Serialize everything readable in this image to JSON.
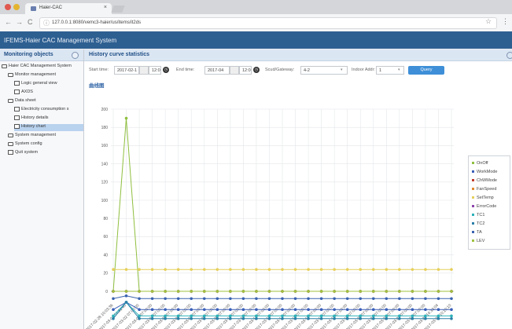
{
  "browser": {
    "tab_title": "Haier-CAC",
    "tab_close": "×",
    "url": "127.0.0.1:8080/vemc3-haier/us/items/it2ds",
    "back": "←",
    "forward": "→",
    "reload": "C",
    "info": "ⓘ",
    "star": "☆",
    "menu": "⋮"
  },
  "app": {
    "title": "IFEMS-Haier CAC Management System"
  },
  "sidebar": {
    "title": "Monitoring objects",
    "items": [
      {
        "label": "Haier CAC Management System",
        "icon": "folder",
        "level": 0
      },
      {
        "label": "Monitor management",
        "icon": "folder",
        "level": 1
      },
      {
        "label": "Logic general view",
        "icon": "page",
        "level": 2
      },
      {
        "label": "AXDS",
        "icon": "page",
        "level": 2
      },
      {
        "label": "Data sheet",
        "icon": "folder",
        "level": 1
      },
      {
        "label": "Electricity consumption s",
        "icon": "page",
        "level": 2
      },
      {
        "label": "History details",
        "icon": "page",
        "level": 2
      },
      {
        "label": "History chart",
        "icon": "page",
        "level": 2,
        "selected": true
      },
      {
        "label": "System management",
        "icon": "folder",
        "level": 1
      },
      {
        "label": "System config",
        "icon": "folder",
        "level": 1
      },
      {
        "label": "Quit system",
        "icon": "page",
        "level": 1
      }
    ]
  },
  "main": {
    "title": "History curve statistics",
    "section_label": "曲线图",
    "filters": {
      "start_label": "Start time:",
      "start_date": "2017-02-1",
      "start_time": "12:02",
      "end_label": "End time:",
      "end_date": "2017-04",
      "end_time": "12:02",
      "gateway_label": "Scud/Gateway:",
      "gateway_value": "4-2",
      "addr_label": "Indoor Addr:",
      "addr_value": "1",
      "query_label": "Query"
    }
  },
  "chart_data": {
    "type": "line",
    "title": "",
    "xlabel": "",
    "ylabel": "",
    "ylim": [
      0,
      200
    ],
    "yticks": [
      0,
      20,
      40,
      60,
      80,
      100,
      120,
      140,
      160,
      180,
      200
    ],
    "grid": true,
    "legend_position": "right",
    "categories": [
      "2017-02-28 10:03:36",
      "2017-03-01 14:31:40",
      "2017-03-02 07:00:00",
      "2017-03-03 07:00:00",
      "2017-03-04 07:00:00",
      "2017-03-05 07:00:00",
      "2017-03-06 07:00:00",
      "2017-03-07 07:00:00",
      "2017-03-08 07:00:00",
      "2017-03-09 07:00:00",
      "2017-03-10 07:00:00",
      "2017-03-11 07:00:00",
      "2017-03-12 07:00:00",
      "2017-03-13 07:00:00",
      "2017-03-14 07:00:00",
      "2017-03-15 07:00:00",
      "2017-03-16 07:00:00",
      "2017-03-17 07:00:00",
      "2017-03-18 07:00:00",
      "2017-03-19 07:00:00",
      "2017-03-20 07:00:00",
      "2017-03-21 07:00:00",
      "2017-03-22 07:00:00",
      "2017-03-23 07:00:00",
      "2017-03-24 07:00:00",
      "2017-03-25 14:33:04",
      "2017-03-26 10:10:10"
    ],
    "series": [
      {
        "name": "OnOff",
        "color": "#8fbf3f",
        "values": [
          0,
          190,
          0,
          0,
          0,
          0,
          0,
          0,
          0,
          0,
          0,
          0,
          0,
          0,
          0,
          0,
          0,
          0,
          0,
          0,
          0,
          0,
          0,
          0,
          0,
          0,
          0
        ]
      },
      {
        "name": "WorkMode",
        "color": "#3a5fb8",
        "values": [
          -20,
          -12,
          -20,
          -20,
          -20,
          -20,
          -20,
          -20,
          -20,
          -20,
          -20,
          -20,
          -20,
          -20,
          -20,
          -20,
          -20,
          -20,
          -20,
          -20,
          -20,
          -20,
          -20,
          -20,
          -20,
          -20,
          -20
        ]
      },
      {
        "name": "ChWMode",
        "color": "#c0392b",
        "values": [
          0,
          0,
          0,
          0,
          0,
          0,
          0,
          0,
          0,
          0,
          0,
          0,
          0,
          0,
          0,
          0,
          0,
          0,
          0,
          0,
          0,
          0,
          0,
          0,
          0,
          0,
          0
        ]
      },
      {
        "name": "FanSpeed",
        "color": "#e08a2e",
        "values": [
          0,
          0,
          0,
          0,
          0,
          0,
          0,
          0,
          0,
          0,
          0,
          0,
          0,
          0,
          0,
          0,
          0,
          0,
          0,
          0,
          0,
          0,
          0,
          0,
          0,
          0,
          0
        ]
      },
      {
        "name": "SetTemp",
        "color": "#e6cf5a",
        "values": [
          24,
          24,
          24,
          24,
          24,
          24,
          24,
          24,
          24,
          24,
          24,
          24,
          24,
          24,
          24,
          24,
          24,
          24,
          24,
          24,
          24,
          24,
          24,
          24,
          24,
          24,
          24
        ]
      },
      {
        "name": "ErrorCode",
        "color": "#8e44ad",
        "values": [
          0,
          0,
          0,
          0,
          0,
          0,
          0,
          0,
          0,
          0,
          0,
          0,
          0,
          0,
          0,
          0,
          0,
          0,
          0,
          0,
          0,
          0,
          0,
          0,
          0,
          0,
          0
        ]
      },
      {
        "name": "TC1",
        "color": "#2bb1b8",
        "values": [
          -27,
          -12,
          -27,
          -27,
          -27,
          -27,
          -27,
          -27,
          -27,
          -27,
          -27,
          -27,
          -27,
          -27,
          -27,
          -27,
          -27,
          -27,
          -27,
          -27,
          -27,
          -27,
          -27,
          -27,
          -27,
          -27,
          -27
        ]
      },
      {
        "name": "TC2",
        "color": "#2a7fa8",
        "values": [
          -30,
          -12,
          -30,
          -30,
          -30,
          -30,
          -30,
          -30,
          -30,
          -30,
          -30,
          -30,
          -30,
          -30,
          -30,
          -30,
          -30,
          -30,
          -30,
          -30,
          -30,
          -30,
          -30,
          -30,
          -30,
          -30,
          -30
        ]
      },
      {
        "name": "TA",
        "color": "#3a63b0",
        "values": [
          -8,
          -5,
          -8,
          -8,
          -8,
          -8,
          -8,
          -8,
          -8,
          -8,
          -8,
          -8,
          -8,
          -8,
          -8,
          -8,
          -8,
          -8,
          -8,
          -8,
          -8,
          -8,
          -8,
          -8,
          -8,
          -8,
          -8
        ]
      },
      {
        "name": "LEV",
        "color": "#9fc23f",
        "values": [
          0,
          0,
          0,
          0,
          0,
          0,
          0,
          0,
          0,
          0,
          0,
          0,
          0,
          0,
          0,
          0,
          0,
          0,
          0,
          0,
          0,
          0,
          0,
          0,
          0,
          0,
          0
        ]
      }
    ]
  }
}
